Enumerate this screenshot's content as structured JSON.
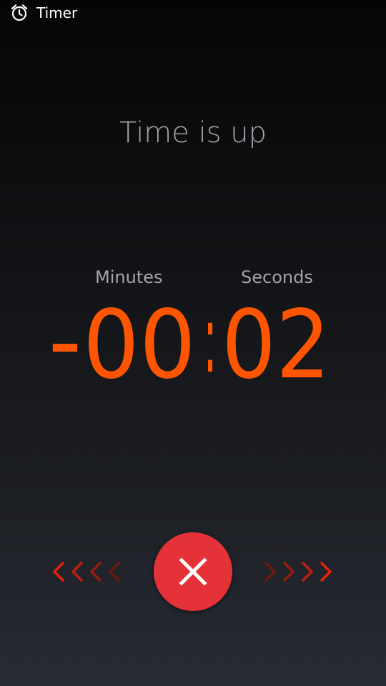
{
  "header": {
    "icon": "alarm-clock-icon",
    "title": "Timer"
  },
  "alert": {
    "headline": "Time is up"
  },
  "readout": {
    "minutes_label": "Minutes",
    "seconds_label": "Seconds",
    "sign": "−",
    "minutes": "00",
    "separator": ":",
    "seconds": "02"
  },
  "dismiss": {
    "icon": "close-icon",
    "color": "#e53238"
  },
  "colors": {
    "accent": "#ff5400",
    "muted_text": "#a3a5a8",
    "chevrons_dark": "#7a1a0c",
    "chevrons_bright": "#e8210c"
  },
  "swipe_hints": {
    "left_icon": "chevron-left-icon",
    "right_icon": "chevron-right-icon"
  }
}
